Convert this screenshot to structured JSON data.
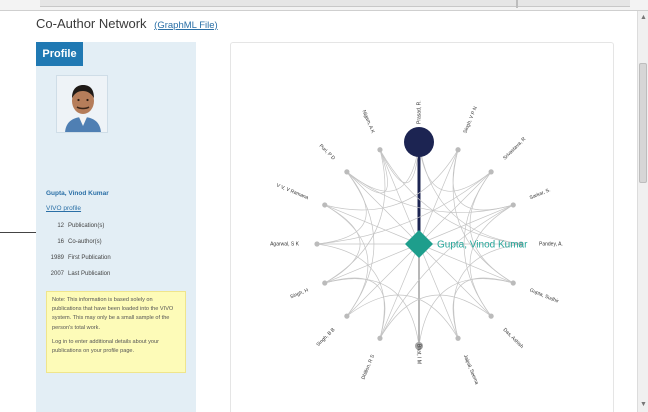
{
  "header": {
    "title": "Co-Author Network",
    "graphml_link": "(GraphML File)"
  },
  "profile": {
    "tab_label": "Profile",
    "name": "Gupta, Vinod Kumar",
    "vivo_link": "VIVO profile",
    "stats": [
      {
        "value": "12",
        "label": "Publication(s)"
      },
      {
        "value": "16",
        "label": "Co-author(s)"
      },
      {
        "value": "1989",
        "label": "First Publication"
      },
      {
        "value": "2007",
        "label": "Last Publication"
      }
    ],
    "note_line1": "Note: This information is based solely on publications that have been loaded into the VIVO system. This may only be a small sample of the person's total work.",
    "note_line2": "Log in to enter additional details about your publications on your profile page."
  },
  "network": {
    "center": "Gupta, Vinod Kumar",
    "coauthors": [
      "Prasad, R.",
      "Singh, V P N",
      "Srivastava, R",
      "Sarkar, S.",
      "Pandey, A.",
      "Gupta, Sudhir",
      "Das, Ashish",
      "Jaipal, Seema",
      "Bhat, I M",
      "Dhillon, R S",
      "Singh, B B",
      "Singh, H",
      "Agarwal, S K",
      "V V, V Ramana",
      "Puri, P D",
      "Nigam, A K"
    ],
    "colors": {
      "center": "#1e9e8c",
      "top_node": "#1c2452",
      "edge": "#c4c4c4",
      "strong_edge": "#1c2452"
    }
  }
}
